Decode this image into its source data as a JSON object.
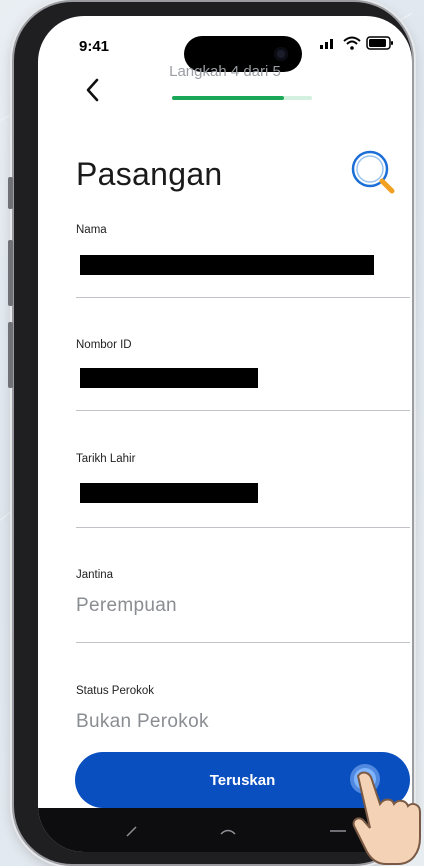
{
  "status_bar": {
    "time": "9:41"
  },
  "header": {
    "step_text": "Langkah 4 dari 5",
    "progress_fraction": 0.8
  },
  "page": {
    "title": "Pasangan"
  },
  "fields": [
    {
      "label": "Nama",
      "value": ""
    },
    {
      "label": "Nombor ID",
      "value": ""
    },
    {
      "label": "Tarikh Lahir",
      "value": ""
    },
    {
      "label": "Jantina",
      "value": "Perempuan"
    },
    {
      "label": "Status Perokok",
      "value": "Bukan Perokok"
    }
  ],
  "actions": {
    "continue_label": "Teruskan"
  },
  "colors": {
    "accent": "#0a4fbf",
    "progress": "#1aa757",
    "progress_track": "#d4f0de",
    "search_icon": "#1c6fd6",
    "search_handle": "#f2a020"
  },
  "icons": [
    "back-chevron-icon",
    "search-icon",
    "signal-icon",
    "wifi-icon",
    "battery-icon",
    "nav-back-icon",
    "nav-home-icon",
    "nav-recents-icon"
  ]
}
